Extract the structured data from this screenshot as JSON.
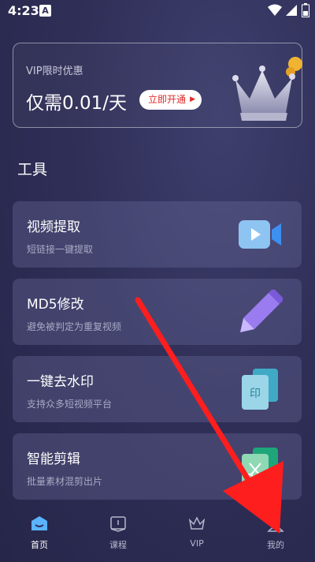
{
  "status_bar": {
    "time": "4:23",
    "notification_badge": "A"
  },
  "vip_banner": {
    "subtitle": "VIP限时优惠",
    "price_text": "仅需0.01/天",
    "button_label": "立即开通"
  },
  "tools_section": {
    "title": "工具",
    "items": [
      {
        "title": "视频提取",
        "desc": "短链接一键提取",
        "icon": "video-camera-icon"
      },
      {
        "title": "MD5修改",
        "desc": "避免被判定为重复视频",
        "icon": "pen-icon"
      },
      {
        "title": "一键去水印",
        "desc": "支持众多短视频平台",
        "icon": "stamp-icon"
      },
      {
        "title": "智能剪辑",
        "desc": "批量素材混剪出片",
        "icon": "scissors-icon"
      }
    ]
  },
  "bottom_nav": {
    "items": [
      {
        "label": "首页",
        "icon": "home-icon",
        "active": true
      },
      {
        "label": "课程",
        "icon": "course-icon",
        "active": false
      },
      {
        "label": "VIP",
        "icon": "crown-icon",
        "active": false
      },
      {
        "label": "我的",
        "icon": "profile-icon",
        "active": false
      }
    ]
  },
  "colors": {
    "background": "#2f2f58",
    "card": "#4a4a78",
    "accent_red": "#e02a2a",
    "home_accent": "#5bb3ff"
  }
}
